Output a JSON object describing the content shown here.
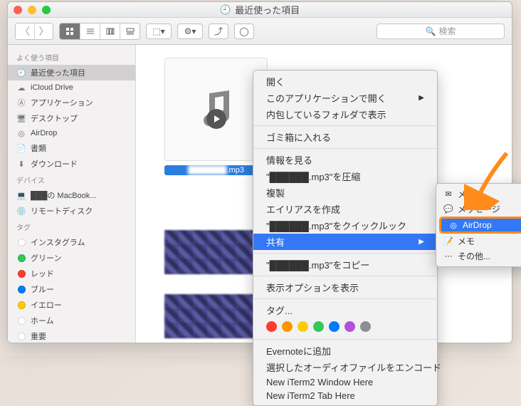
{
  "window": {
    "title": "最近使った項目"
  },
  "search": {
    "placeholder": "検索"
  },
  "sidebar": {
    "sections": [
      {
        "header": "よく使う項目",
        "items": [
          {
            "label": "最近使った項目",
            "icon": "recent",
            "selected": true
          },
          {
            "label": "iCloud Drive",
            "icon": "cloud"
          },
          {
            "label": "アプリケーション",
            "icon": "apps"
          },
          {
            "label": "デスクトップ",
            "icon": "desktop"
          },
          {
            "label": "AirDrop",
            "icon": "airdrop"
          },
          {
            "label": "書類",
            "icon": "docs"
          },
          {
            "label": "ダウンロード",
            "icon": "downloads"
          }
        ]
      },
      {
        "header": "デバイス",
        "items": [
          {
            "label": "███の MacBook...",
            "icon": "laptop"
          },
          {
            "label": "リモートディスク",
            "icon": "disc"
          }
        ]
      },
      {
        "header": "タグ",
        "items": [
          {
            "label": "インスタグラム",
            "color": "#fff"
          },
          {
            "label": "グリーン",
            "color": "#34c759"
          },
          {
            "label": "レッド",
            "color": "#ff3b30"
          },
          {
            "label": "ブルー",
            "color": "#007aff"
          },
          {
            "label": "イエロー",
            "color": "#ffcc00"
          },
          {
            "label": "ホーム",
            "color": "#fff"
          },
          {
            "label": "重要",
            "color": "#fff"
          }
        ]
      }
    ]
  },
  "file": {
    "name_redacted": "███████.mp3"
  },
  "context_menu": {
    "items": [
      {
        "label": "開く"
      },
      {
        "label": "このアプリケーションで開く",
        "submenu": true
      },
      {
        "label": "内包しているフォルダで表示"
      },
      {
        "sep": true
      },
      {
        "label": "ゴミ箱に入れる"
      },
      {
        "sep": true
      },
      {
        "label": "情報を見る"
      },
      {
        "label": "\"██████.mp3\"を圧縮",
        "redacted": true
      },
      {
        "label": "複製"
      },
      {
        "label": "エイリアスを作成"
      },
      {
        "label": "\"██████.mp3\"をクイックルック",
        "redacted": true
      },
      {
        "label": "共有",
        "submenu": true,
        "highlighted": true
      },
      {
        "sep": true
      },
      {
        "label": "\"██████.mp3\"をコピー",
        "redacted": true
      },
      {
        "sep": true
      },
      {
        "label": "表示オプションを表示"
      },
      {
        "sep": true
      },
      {
        "label": "タグ..."
      },
      {
        "tags": true
      },
      {
        "sep": true
      },
      {
        "label": "Evernoteに追加"
      },
      {
        "label": "選択したオーディオファイルをエンコード"
      },
      {
        "label": "New iTerm2 Window Here"
      },
      {
        "label": "New iTerm2 Tab Here"
      }
    ],
    "tag_colors": [
      "#ff3b30",
      "#ff9500",
      "#ffcc00",
      "#34c759",
      "#007aff",
      "#af52de",
      "#8e8e93"
    ]
  },
  "share_submenu": {
    "items": [
      {
        "label": "メール",
        "icon": "✉"
      },
      {
        "label": "メッセージ",
        "icon": "💬"
      },
      {
        "label": "AirDrop",
        "icon": "◎",
        "highlighted": true
      },
      {
        "label": "メモ",
        "icon": "📝"
      },
      {
        "label": "その他...",
        "icon": "⋯"
      }
    ]
  }
}
